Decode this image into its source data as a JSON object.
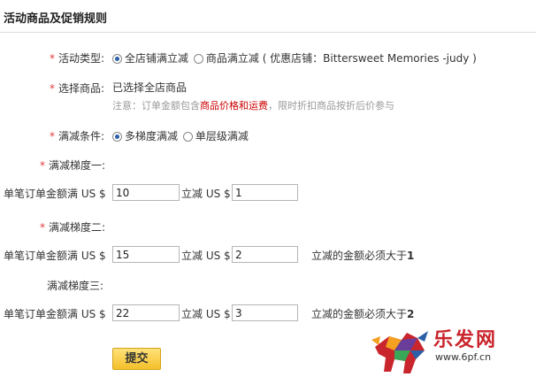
{
  "section_title": "活动商品及促销规则",
  "activity_type": {
    "label": "活动类型:",
    "options": [
      "全店铺满立减",
      "商品满立减"
    ],
    "selected": 0,
    "store_info": "( 优惠店铺：Bittersweet Memories -judy )"
  },
  "select_goods": {
    "label": "选择商品:",
    "value": "已选择全店商品",
    "note_prefix": "注意：订单金额包含",
    "note_highlight": "商品价格和运费",
    "note_suffix": "，限时折扣商品按折后价参与"
  },
  "discount_condition": {
    "label": "满减条件:",
    "options": [
      "多梯度满减",
      "单层级满减"
    ],
    "selected": 0
  },
  "tiers": [
    {
      "label": "满减梯度一:",
      "order_label": "单笔订单金额满 US $",
      "order_value": "10",
      "reduce_label": "立减 US $",
      "reduce_value": "1",
      "hint": ""
    },
    {
      "label": "满减梯度二:",
      "order_label": "单笔订单金额满 US $",
      "order_value": "15",
      "reduce_label": "立减 US $",
      "reduce_value": "2",
      "hint_text": "立减的金额必须大于",
      "hint_value": "1"
    },
    {
      "label": "满减梯度三:",
      "order_label": "单笔订单金额满 US $",
      "order_value": "22",
      "reduce_label": "立减 US $",
      "reduce_value": "3",
      "hint_text": "立减的金额必须大于",
      "hint_value": "2"
    }
  ],
  "submit_label": "提交",
  "watermark": {
    "brand": "乐发网",
    "url": "www.6pf.cn",
    "colors": [
      "#c9252c",
      "#2b5fa8",
      "#f4a020",
      "#6a3d9a"
    ]
  },
  "required_mark": "*"
}
